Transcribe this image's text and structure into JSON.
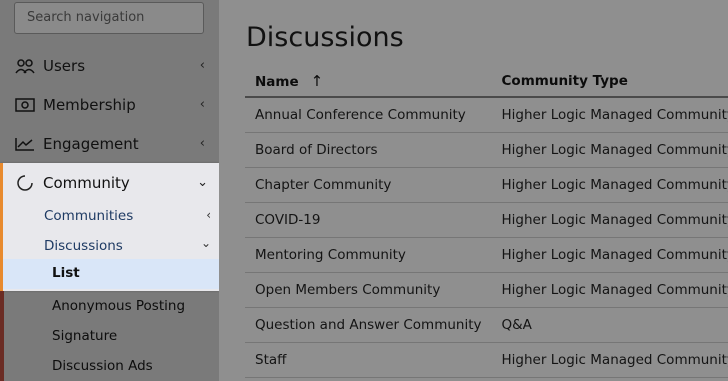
{
  "sidebar": {
    "search_placeholder": "Search navigation",
    "items": [
      {
        "label": "Users",
        "icon": "users-icon"
      },
      {
        "label": "Membership",
        "icon": "membership-card-icon"
      },
      {
        "label": "Engagement",
        "icon": "trend-chart-icon"
      },
      {
        "label": "Community",
        "icon": "circle-icon"
      }
    ],
    "community_sub": {
      "communities": "Communities",
      "discussions": "Discussions",
      "list": "List",
      "anonymous_posting": "Anonymous Posting",
      "signature": "Signature",
      "discussion_ads": "Discussion Ads"
    },
    "accent_color": "#e88a2e"
  },
  "main": {
    "title": "Discussions",
    "columns": [
      "Name",
      "Community Type"
    ],
    "rows": [
      [
        "Annual Conference Community",
        "Higher Logic Managed Community"
      ],
      [
        "Board of Directors",
        "Higher Logic Managed Community"
      ],
      [
        "Chapter Community",
        "Higher Logic Managed Community"
      ],
      [
        "COVID-19",
        "Higher Logic Managed Community"
      ],
      [
        "Mentoring Community",
        "Higher Logic Managed Community"
      ],
      [
        "Open Members Community",
        "Higher Logic Managed Community"
      ],
      [
        "Question and Answer Community",
        "Q&A"
      ],
      [
        "Staff",
        "Higher Logic Managed Community"
      ]
    ]
  }
}
